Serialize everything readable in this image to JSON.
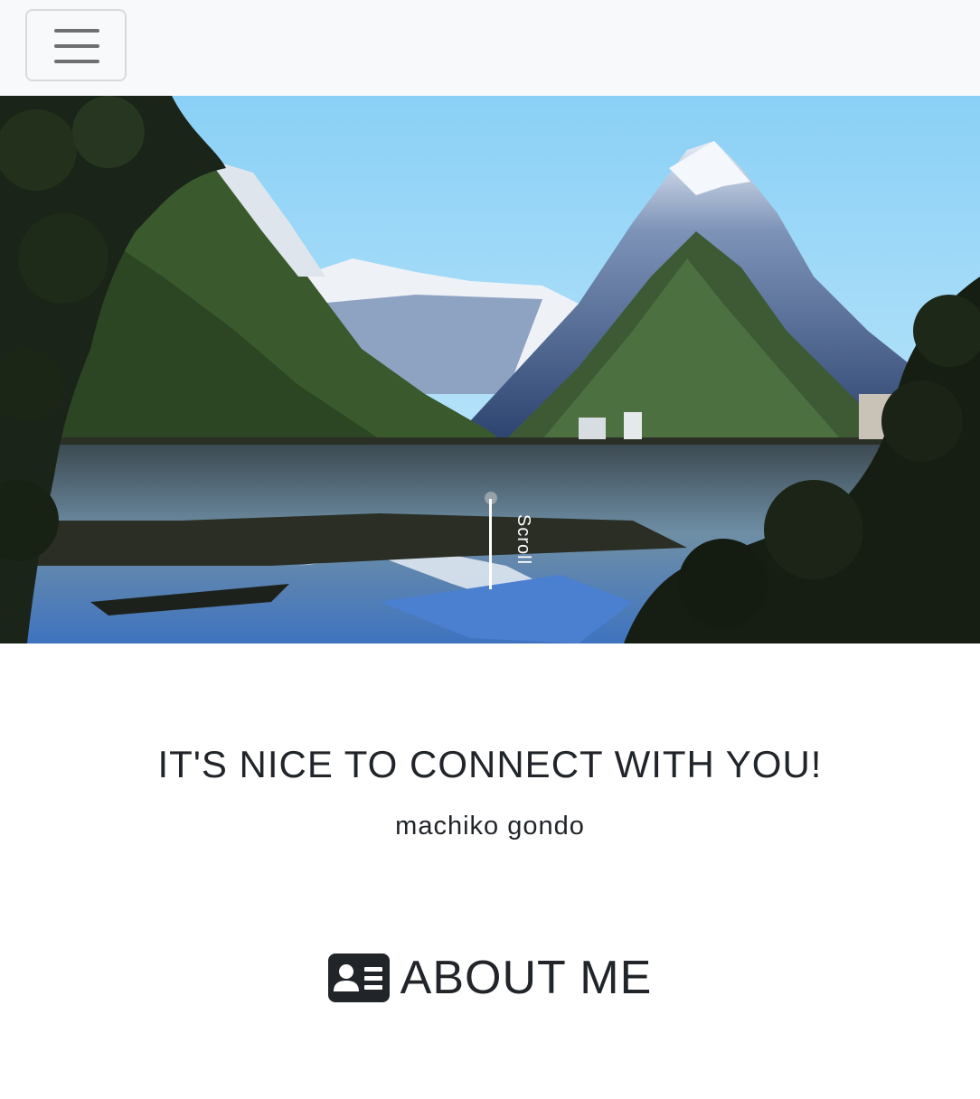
{
  "navbar": {
    "toggle_icon": "hamburger-menu-icon"
  },
  "hero": {
    "scroll_label": "Scroll",
    "scroll_icon": "scroll-indicator-line"
  },
  "intro": {
    "greeting": "IT'S NICE TO CONNECT WITH YOU!",
    "name": "machiko gondo"
  },
  "about": {
    "icon": "id-card-icon",
    "title": "ABOUT ME"
  },
  "colors": {
    "navbar_bg": "#f8f9fa",
    "text": "#212529",
    "sky": "#8fd3f7"
  }
}
